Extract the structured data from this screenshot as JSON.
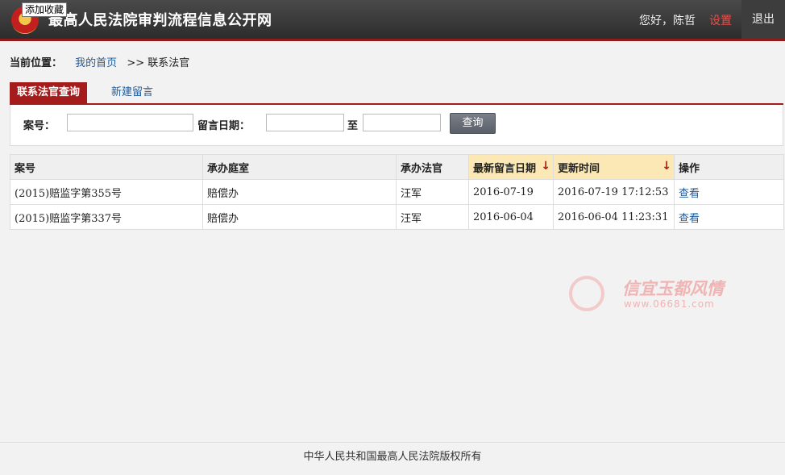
{
  "header": {
    "site_title": "最高人民法院审判流程信息公开网",
    "bookmark_tooltip": "添加收藏",
    "greeting": "您好，陈哲",
    "settings_label": "设置",
    "logout_label": "退出"
  },
  "breadcrumb": {
    "label": "当前位置：",
    "home": "我的首页",
    "separator": ">>",
    "current": "联系法官"
  },
  "tabs": [
    {
      "label": "联系法官查询",
      "active": true
    },
    {
      "label": "新建留言",
      "active": false
    }
  ],
  "search": {
    "case_label": "案号：",
    "case_value": "",
    "date_label": "留言日期：",
    "date_from": "",
    "to_label": "至",
    "date_to": "",
    "button": "查询"
  },
  "table": {
    "columns": [
      "案号",
      "承办庭室",
      "承办法官",
      "最新留言日期",
      "更新时间",
      "操作"
    ],
    "sort_icon": "arrow-down-icon",
    "rows": [
      {
        "case_no": "(2015)赔监字第355号",
        "department": "赔偿办",
        "judge": "汪军",
        "last_msg_date": "2016-07-19",
        "updated": "2016-07-19 17:12:53",
        "action": "查看"
      },
      {
        "case_no": "(2015)赔监字第337号",
        "department": "赔偿办",
        "judge": "汪军",
        "last_msg_date": "2016-06-04",
        "updated": "2016-06-04 11:23:31",
        "action": "查看"
      }
    ]
  },
  "watermark": {
    "title": "信宜玉都风情",
    "url": "www.06681.com"
  },
  "footer": {
    "copyright": "中华人民共和国最高人民法院版权所有"
  },
  "colors": {
    "accent_red": "#a51c1c",
    "link_blue": "#1f5b9c",
    "sorted_header": "#fbe8b4"
  }
}
